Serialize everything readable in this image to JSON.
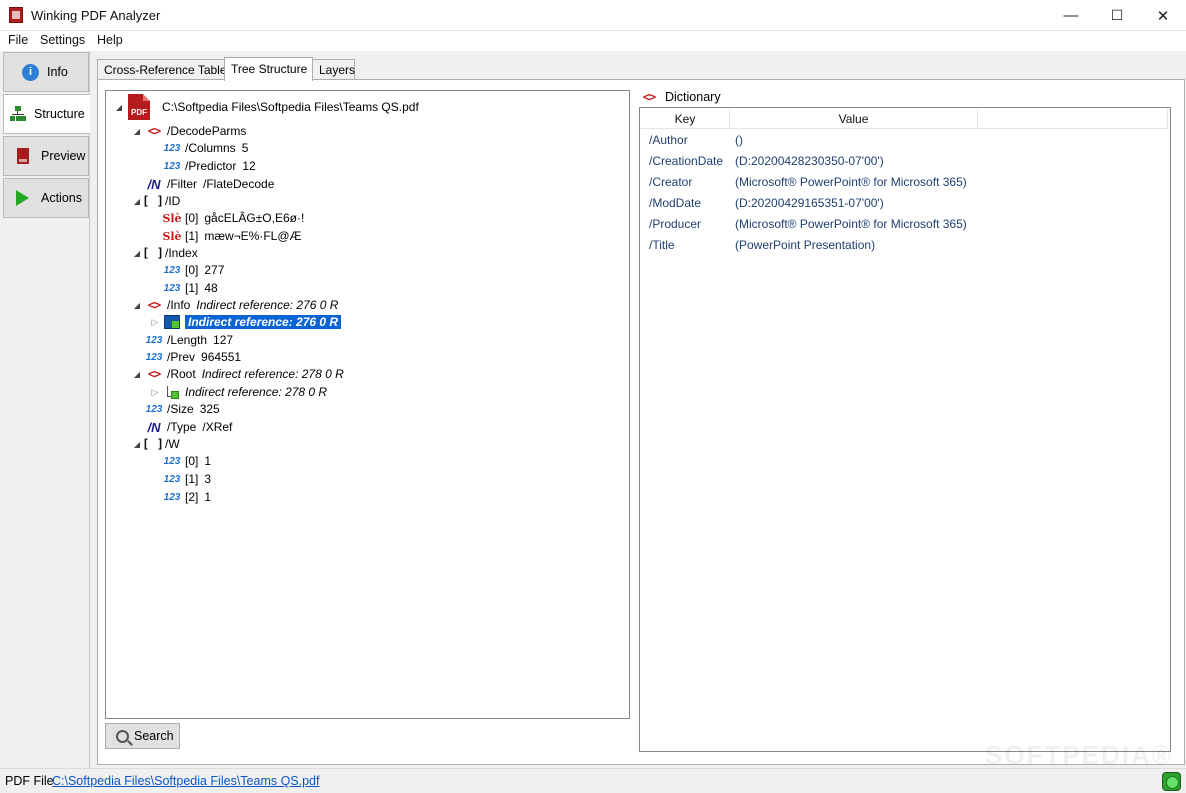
{
  "window": {
    "title": "Winking PDF Analyzer",
    "minimize": "—",
    "maximize": "☐",
    "close": "✕"
  },
  "menu": {
    "items": [
      "File",
      "Settings",
      "Help"
    ]
  },
  "nav": {
    "items": [
      {
        "label": "Info",
        "icon": "info-icon"
      },
      {
        "label": "Structure",
        "icon": "structure-icon"
      },
      {
        "label": "Preview",
        "icon": "preview-icon"
      },
      {
        "label": "Actions",
        "icon": "play-icon"
      }
    ],
    "active": "Structure"
  },
  "tabs": {
    "items": [
      "Cross-Reference Table",
      "Tree Structure",
      "Layers"
    ],
    "active": "Tree Structure"
  },
  "tree": {
    "root": {
      "label": "C:\\Softpedia Files\\Softpedia Files\\Teams QS.pdf",
      "icon_text": "PDF"
    },
    "nodes": [
      {
        "key": "/DecodeParms",
        "value": ""
      },
      {
        "key": "/Columns",
        "value": "5"
      },
      {
        "key": "/Predictor",
        "value": "12"
      },
      {
        "key": "/Filter",
        "value": "/FlateDecode"
      },
      {
        "key": "/ID",
        "value": ""
      },
      {
        "key": "[0]",
        "value": "gåcELÂG±O,E6ø·!"
      },
      {
        "key": "[1]",
        "value": "mæw¬E%·FL@Æ"
      },
      {
        "key": "/Index",
        "value": ""
      },
      {
        "key": "[0]",
        "value": "277"
      },
      {
        "key": "[1]",
        "value": "48"
      },
      {
        "key": "/Info",
        "value": "Indirect reference: 276 0 R"
      },
      {
        "key": "",
        "value": "Indirect reference: 276 0 R"
      },
      {
        "key": "/Length",
        "value": "127"
      },
      {
        "key": "/Prev",
        "value": "964551"
      },
      {
        "key": "/Root",
        "value": "Indirect reference: 278 0 R"
      },
      {
        "key": "",
        "value": "Indirect reference: 278 0 R"
      },
      {
        "key": "/Size",
        "value": "325"
      },
      {
        "key": "/Type",
        "value": "/XRef"
      },
      {
        "key": "/W",
        "value": ""
      },
      {
        "key": "[0]",
        "value": "1"
      },
      {
        "key": "[1]",
        "value": "3"
      },
      {
        "key": "[2]",
        "value": "1"
      }
    ],
    "icons": {
      "dict": "<>",
      "num": "123",
      "name": "/N",
      "array": "[ ]",
      "string": "Slè"
    }
  },
  "search_button": "Search",
  "dictionary": {
    "title": "Dictionary",
    "columns": [
      "Key",
      "Value"
    ],
    "rows": [
      {
        "key": "/Author",
        "value": "()"
      },
      {
        "key": "/CreationDate",
        "value": "(D:20200428230350-07'00')"
      },
      {
        "key": "/Creator",
        "value": "(Microsoft® PowerPoint® for Microsoft 365)"
      },
      {
        "key": "/ModDate",
        "value": "(D:20200429165351-07'00')"
      },
      {
        "key": "/Producer",
        "value": "(Microsoft® PowerPoint® for Microsoft 365)"
      },
      {
        "key": "/Title",
        "value": "(PowerPoint Presentation)"
      }
    ]
  },
  "status": {
    "label": "PDF File",
    "path": "C:\\Softpedia Files\\Softpedia Files\\Teams QS.pdf"
  },
  "watermark": "SOFTPEDIA®"
}
